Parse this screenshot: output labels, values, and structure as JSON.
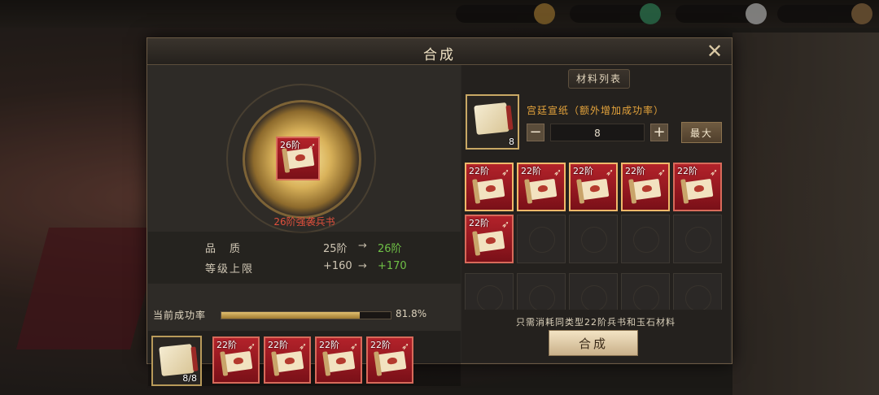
{
  "dialog": {
    "title": "合成",
    "close_icon": "close-icon"
  },
  "target_item": {
    "tier_badge": "26阶",
    "name": "26阶强袭兵书"
  },
  "stats": [
    {
      "label": "品　质",
      "from": "25阶",
      "arrow": "→",
      "to": "26阶"
    },
    {
      "label": "等级上限",
      "from": "+160",
      "arrow": "→",
      "to": "+170"
    }
  ],
  "success_rate": {
    "label": "当前成功率",
    "value": "81.8%",
    "fraction": 0.818
  },
  "left_materials": {
    "paper_count": "8/8",
    "tiles": [
      "22阶",
      "22阶",
      "22阶",
      "22阶"
    ]
  },
  "material_list": {
    "tab_label": "材料列表",
    "paper_name": "宫廷宣纸（额外增加成功率）",
    "paper_stack": "8",
    "minus_label": "−",
    "quantity": "8",
    "plus_label": "+",
    "max_label": "最大",
    "grid_items": [
      "22阶",
      "22阶",
      "22阶",
      "22阶",
      "22阶",
      "22阶"
    ],
    "hint": "只需消耗同类型22阶兵书和玉石材料",
    "compose_label": "合成"
  },
  "colors": {
    "accent_gold": "#c9a865",
    "upgrade_green": "#6fc046",
    "item_red": "#b3222a",
    "title_text": "#efe2c4"
  }
}
